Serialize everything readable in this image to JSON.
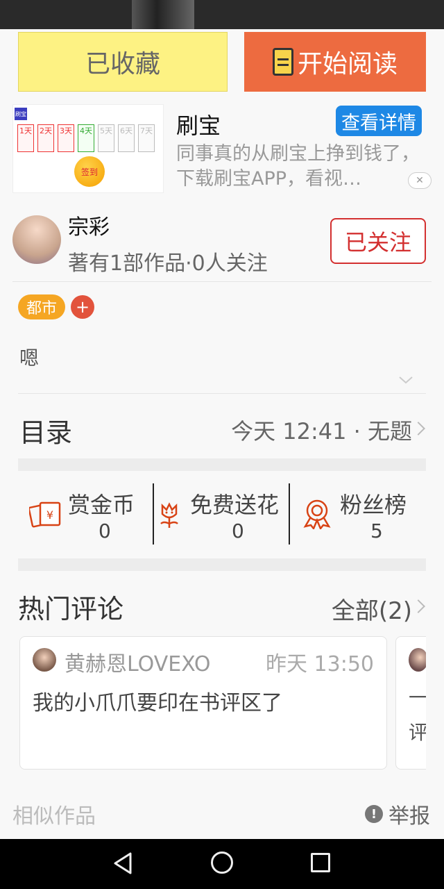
{
  "actions": {
    "favorite_label": "已收藏",
    "read_label": "开始阅读"
  },
  "ad": {
    "logo_text": "刷宝",
    "days": [
      "1天",
      "2天",
      "3天",
      "4天",
      "5天",
      "6天",
      "7天"
    ],
    "signin_label": "签到",
    "title": "刷宝",
    "detail_button": "查看详情",
    "description": "同事真的从刷宝上挣到钱了，下载刷宝APP，看视…"
  },
  "author": {
    "name": "宗彩",
    "stats": "著有1部作品·0人关注",
    "follow_label": "已关注"
  },
  "tags": [
    {
      "label": "都市"
    }
  ],
  "tag_add": "+",
  "intro": "嗯",
  "toc": {
    "title": "目录",
    "latest": "今天 12:41 · 无题"
  },
  "stats": [
    {
      "label": "赏金币",
      "value": "0",
      "icon": "reward-envelope-icon"
    },
    {
      "label": "免费送花",
      "value": "0",
      "icon": "flower-icon"
    },
    {
      "label": "粉丝榜",
      "value": "5",
      "icon": "badge-icon"
    }
  ],
  "hot_comments": {
    "title": "热门评论",
    "all_label": "全部(2)",
    "items": [
      {
        "user": "黄赫恩LOVEXO",
        "time": "昨天 13:50",
        "text": "我的小爪爪要印在书评区了"
      },
      {
        "line1": "一",
        "line2": "评"
      }
    ]
  },
  "footer": {
    "similar": "相似作品",
    "report": "举报"
  },
  "colors": {
    "accent": "#ed6b40",
    "favorite_bg": "#fdf283",
    "follow": "#d32f2f",
    "tag": "#f5a623",
    "ad_button": "#1e88e5"
  }
}
